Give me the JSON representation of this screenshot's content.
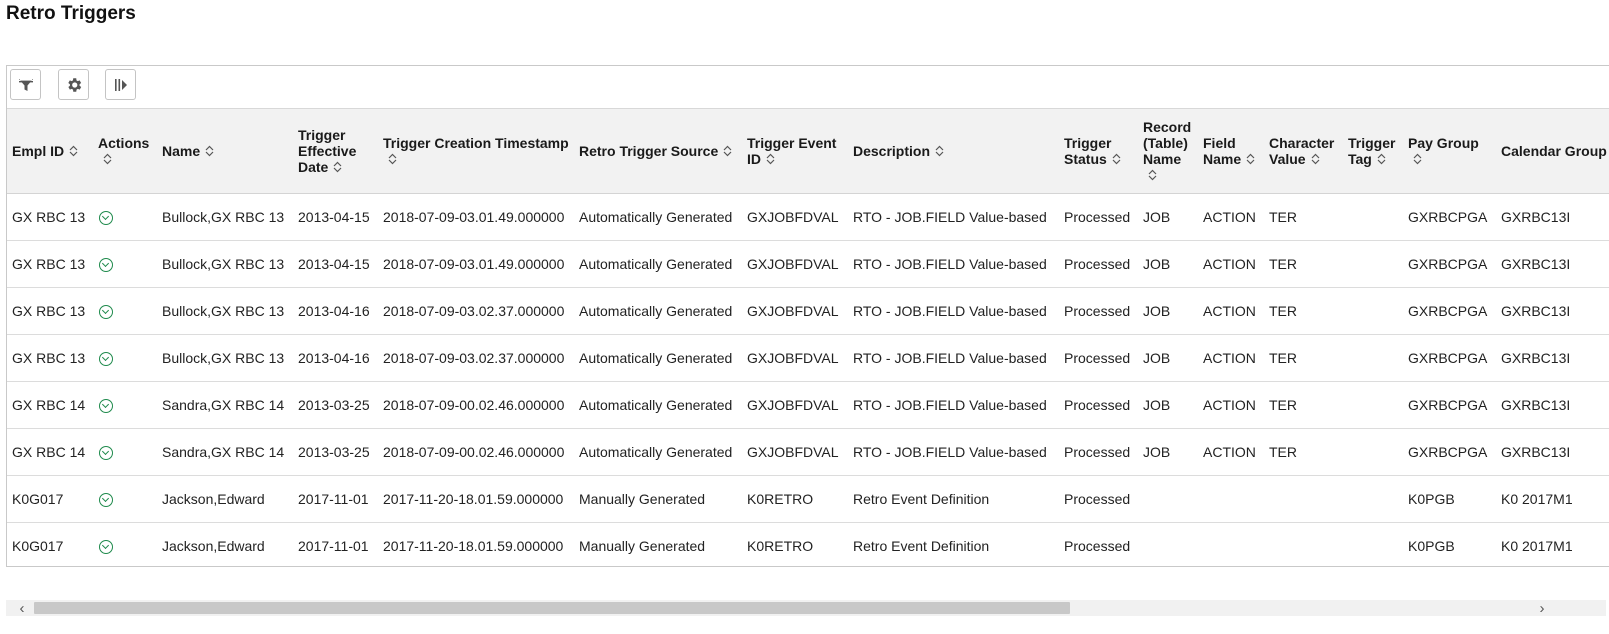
{
  "page": {
    "title": "Retro Triggers"
  },
  "toolbar": {
    "buttons": [
      {
        "name": "filter-button",
        "icon": "filter-icon"
      },
      {
        "name": "settings-button",
        "icon": "gear-icon"
      },
      {
        "name": "columns-button",
        "icon": "column-freeze-icon"
      }
    ]
  },
  "grid": {
    "columns": [
      {
        "key": "empl_id",
        "label": "Empl ID"
      },
      {
        "key": "actions",
        "label": "Actions"
      },
      {
        "key": "name",
        "label": "Name"
      },
      {
        "key": "trigger_effective_date",
        "label": "Trigger Effective Date"
      },
      {
        "key": "trigger_creation_timestamp",
        "label": "Trigger Creation Timestamp"
      },
      {
        "key": "retro_trigger_source",
        "label": "Retro Trigger Source"
      },
      {
        "key": "trigger_event_id",
        "label": "Trigger Event ID"
      },
      {
        "key": "description",
        "label": "Description"
      },
      {
        "key": "trigger_status",
        "label": "Trigger Status"
      },
      {
        "key": "record_table_name",
        "label": "Record (Table) Name"
      },
      {
        "key": "field_name",
        "label": "Field Name"
      },
      {
        "key": "character_value",
        "label": "Character Value"
      },
      {
        "key": "trigger_tag",
        "label": "Trigger Tag"
      },
      {
        "key": "pay_group",
        "label": "Pay Group"
      },
      {
        "key": "calendar_group_id",
        "label": "Calendar Group ID"
      }
    ],
    "rows": [
      {
        "empl_id": "GX RBC 13",
        "name": "Bullock,GX RBC 13",
        "trigger_effective_date": "2013-04-15",
        "trigger_creation_timestamp": "2018-07-09-03.01.49.000000",
        "retro_trigger_source": "Automatically Generated",
        "trigger_event_id": "GXJOBFDVAL",
        "description": "RTO - JOB.FIELD Value-based",
        "trigger_status": "Processed",
        "record_table_name": "JOB",
        "field_name": "ACTION",
        "character_value": "TER",
        "trigger_tag": "",
        "pay_group": "GXRBCPGA",
        "calendar_group_id": "GXRBC13I"
      },
      {
        "empl_id": "GX RBC 13",
        "name": "Bullock,GX RBC 13",
        "trigger_effective_date": "2013-04-15",
        "trigger_creation_timestamp": "2018-07-09-03.01.49.000000",
        "retro_trigger_source": "Automatically Generated",
        "trigger_event_id": "GXJOBFDVAL",
        "description": "RTO - JOB.FIELD Value-based",
        "trigger_status": "Processed",
        "record_table_name": "JOB",
        "field_name": "ACTION",
        "character_value": "TER",
        "trigger_tag": "",
        "pay_group": "GXRBCPGA",
        "calendar_group_id": "GXRBC13I"
      },
      {
        "empl_id": "GX RBC 13",
        "name": "Bullock,GX RBC 13",
        "trigger_effective_date": "2013-04-16",
        "trigger_creation_timestamp": "2018-07-09-03.02.37.000000",
        "retro_trigger_source": "Automatically Generated",
        "trigger_event_id": "GXJOBFDVAL",
        "description": "RTO - JOB.FIELD Value-based",
        "trigger_status": "Processed",
        "record_table_name": "JOB",
        "field_name": "ACTION",
        "character_value": "TER",
        "trigger_tag": "",
        "pay_group": "GXRBCPGA",
        "calendar_group_id": "GXRBC13I"
      },
      {
        "empl_id": "GX RBC 13",
        "name": "Bullock,GX RBC 13",
        "trigger_effective_date": "2013-04-16",
        "trigger_creation_timestamp": "2018-07-09-03.02.37.000000",
        "retro_trigger_source": "Automatically Generated",
        "trigger_event_id": "GXJOBFDVAL",
        "description": "RTO - JOB.FIELD Value-based",
        "trigger_status": "Processed",
        "record_table_name": "JOB",
        "field_name": "ACTION",
        "character_value": "TER",
        "trigger_tag": "",
        "pay_group": "GXRBCPGA",
        "calendar_group_id": "GXRBC13I"
      },
      {
        "empl_id": "GX RBC 14",
        "name": "Sandra,GX RBC 14",
        "trigger_effective_date": "2013-03-25",
        "trigger_creation_timestamp": "2018-07-09-00.02.46.000000",
        "retro_trigger_source": "Automatically Generated",
        "trigger_event_id": "GXJOBFDVAL",
        "description": "RTO - JOB.FIELD Value-based",
        "trigger_status": "Processed",
        "record_table_name": "JOB",
        "field_name": "ACTION",
        "character_value": "TER",
        "trigger_tag": "",
        "pay_group": "GXRBCPGA",
        "calendar_group_id": "GXRBC13I"
      },
      {
        "empl_id": "GX RBC 14",
        "name": "Sandra,GX RBC 14",
        "trigger_effective_date": "2013-03-25",
        "trigger_creation_timestamp": "2018-07-09-00.02.46.000000",
        "retro_trigger_source": "Automatically Generated",
        "trigger_event_id": "GXJOBFDVAL",
        "description": "RTO - JOB.FIELD Value-based",
        "trigger_status": "Processed",
        "record_table_name": "JOB",
        "field_name": "ACTION",
        "character_value": "TER",
        "trigger_tag": "",
        "pay_group": "GXRBCPGA",
        "calendar_group_id": "GXRBC13I"
      },
      {
        "empl_id": "K0G017",
        "name": "Jackson,Edward",
        "trigger_effective_date": "2017-11-01",
        "trigger_creation_timestamp": "2017-11-20-18.01.59.000000",
        "retro_trigger_source": "Manually Generated",
        "trigger_event_id": "K0RETRO",
        "description": "Retro Event Definition",
        "trigger_status": "Processed",
        "record_table_name": "",
        "field_name": "",
        "character_value": "",
        "trigger_tag": "",
        "pay_group": "K0PGB",
        "calendar_group_id": "K0 2017M1"
      },
      {
        "empl_id": "K0G017",
        "name": "Jackson,Edward",
        "trigger_effective_date": "2017-11-01",
        "trigger_creation_timestamp": "2017-11-20-18.01.59.000000",
        "retro_trigger_source": "Manually Generated",
        "trigger_event_id": "K0RETRO",
        "description": "Retro Event Definition",
        "trigger_status": "Processed",
        "record_table_name": "",
        "field_name": "",
        "character_value": "",
        "trigger_tag": "",
        "pay_group": "K0PGB",
        "calendar_group_id": "K0 2017M1"
      }
    ]
  },
  "colors": {
    "action_green": "#1f8a4c",
    "header_bg": "#f2f2f2"
  }
}
